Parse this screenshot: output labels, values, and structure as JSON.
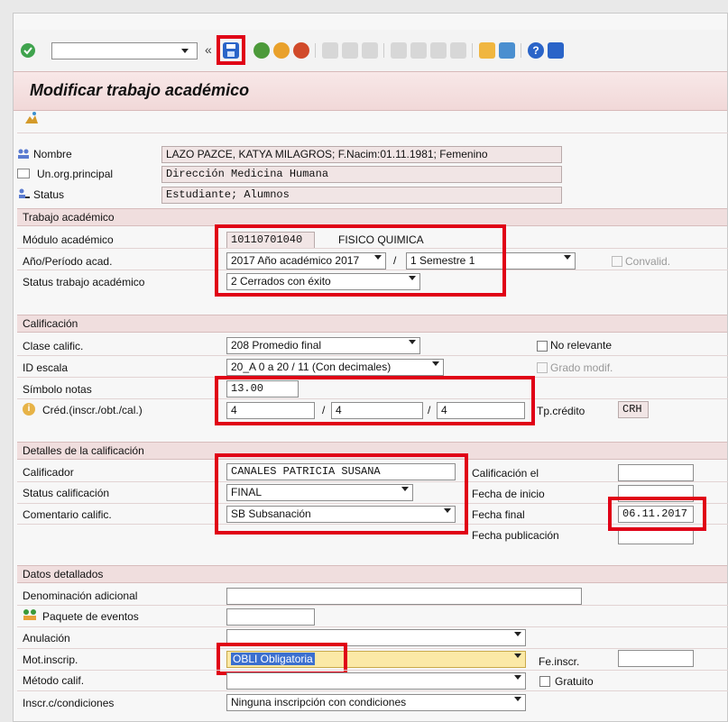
{
  "toolbar": {
    "command_value": "",
    "nav_glyph": "«",
    "icons": [
      "check-icon",
      "save-icon",
      "back-icon",
      "exit-icon",
      "cancel-icon",
      "print-icon",
      "find-icon",
      "find-next-icon",
      "first-page-icon",
      "prev-page-icon",
      "next-page-icon",
      "last-page-icon",
      "new-session-icon",
      "shortcut-icon",
      "help-icon",
      "customize-icon"
    ]
  },
  "page": {
    "title": "Modificar trabajo académico"
  },
  "header_fields": {
    "nombre_label": "Nombre",
    "nombre_value": "LAZO PAZCE, KATYA MILAGROS; F.Nacim:01.11.1981; Femenino",
    "org_label": "Un.org.principal",
    "org_value": "Dirección Medicina Humana",
    "status_label": "Status",
    "status_value": "Estudiante; Alumnos"
  },
  "trabajo": {
    "section": "Trabajo académico",
    "modulo_label": "Módulo académico",
    "modulo_code": "10110701040",
    "modulo_name": "FISICO QUIMICA",
    "anio_label": "Año/Período acad.",
    "anio_value": "2017 Año académico 2017",
    "slash": "/",
    "periodo_value": "1 Semestre 1",
    "convalid_label": "Convalid.",
    "status_label": "Status trabajo académico",
    "status_value": "2 Cerrados con éxito"
  },
  "calificacion": {
    "section": "Calificación",
    "clase_label": "Clase calific.",
    "clase_value": "208 Promedio final",
    "no_relevante_label": "No relevante",
    "escala_label": "ID escala",
    "escala_value": "20_A 0 a 20 / 11 (Con decimales)",
    "grado_label": "Grado modif.",
    "simbolo_label": "Símbolo notas",
    "simbolo_value": "13.00",
    "cred_label": "Créd.(inscr./obt./cal.)",
    "cred_1": "4",
    "cred_2": "4",
    "cred_3": "4",
    "slash": "/",
    "tp_label": "Tp.crédito",
    "tp_value": "CRH"
  },
  "detalles": {
    "section": "Detalles de la calificación",
    "calificador_label": "Calificador",
    "calificador_value": "CANALES PATRICIA SUSANA",
    "status_label": "Status calificación",
    "status_value": "FINAL",
    "comentario_label": "Comentario calific.",
    "comentario_value": "SB Subsanación",
    "calif_el_label": "Calificación el",
    "calif_el_value": "",
    "inicio_label": "Fecha de inicio",
    "inicio_value": "",
    "final_label": "Fecha final",
    "final_value": "06.11.2017",
    "publicacion_label": "Fecha publicación",
    "publicacion_value": ""
  },
  "datos": {
    "section": "Datos detallados",
    "denominacion_label": "Denominación adicional",
    "denominacion_value": "",
    "paquete_label": "Paquete de eventos",
    "paquete_value": "",
    "anulacion_label": "Anulación",
    "anulacion_value": "",
    "mot_label": "Mot.inscrip.",
    "mot_value": "OBLI Obligatoria",
    "feinscr_label": "Fe.inscr.",
    "feinscr_value": "",
    "metodo_label": "Método calif.",
    "metodo_value": "",
    "gratuito_label": "Gratuito",
    "inscr_label": "Inscr.c/condiciones",
    "inscr_value": "Ninguna inscripción con condiciones"
  },
  "colors": {
    "highlight_red": "#e00016",
    "section_bg": "#f0dede",
    "mot_highlight": "#fbe9a6"
  }
}
